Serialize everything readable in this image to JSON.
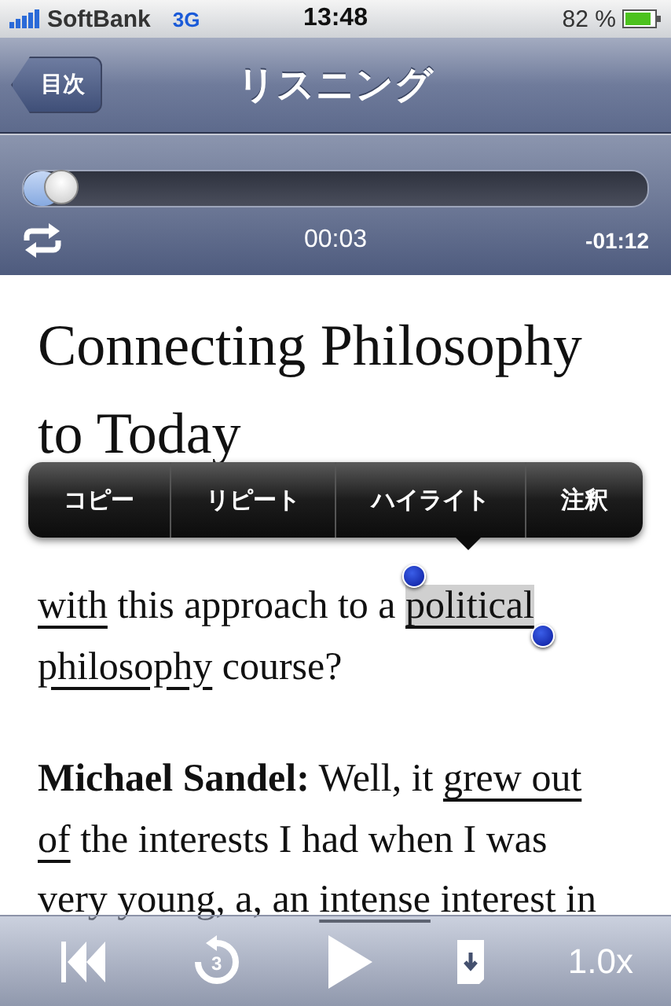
{
  "status_bar": {
    "carrier": "SoftBank",
    "network": "3G",
    "time": "13:48",
    "battery": "82 %"
  },
  "nav_bar": {
    "back_button": "目次",
    "title": "リスニング"
  },
  "player": {
    "progress": {
      "level": 0.06
    },
    "elapsed": "00:03",
    "remaining": "-01:12"
  },
  "article": {
    "title": "Connecting Philosophy to Today",
    "paragraphs": [
      {
        "segments": [
          {
            "text": "with",
            "bold": false,
            "underlined": true,
            "selected": false
          },
          {
            "text": "this approach to a",
            "bold": false,
            "underlined": false,
            "selected": false
          },
          {
            "text": "political",
            "bold": false,
            "underlined": true,
            "selected": true
          },
          {
            "text": "philosophy",
            "bold": false,
            "underlined": true,
            "selected": false
          },
          {
            "text": "course?",
            "bold": false,
            "underlined": false,
            "selected": false
          }
        ]
      },
      {
        "segments": [
          {
            "text": "Michael Sandel:",
            "bold": true,
            "underlined": false,
            "selected": false
          },
          {
            "text": "Well, it",
            "bold": false,
            "underlined": false,
            "selected": false
          },
          {
            "text": "grew out of",
            "bold": false,
            "underlined": true,
            "selected": false
          },
          {
            "text": "the interests I had when I was very young, a, an",
            "bold": false,
            "underlined": false,
            "selected": false
          },
          {
            "text": "intense",
            "bold": false,
            "underlined": true,
            "selected": false
          },
          {
            "text": "interest in",
            "bold": false,
            "underlined": false,
            "selected": false
          }
        ]
      }
    ]
  },
  "context_menu": {
    "items": [
      "コピー",
      "リピート",
      "ハイライト",
      "注釈"
    ]
  },
  "toolbar": {
    "rewind_seconds": "3",
    "speed": "1.0x"
  }
}
